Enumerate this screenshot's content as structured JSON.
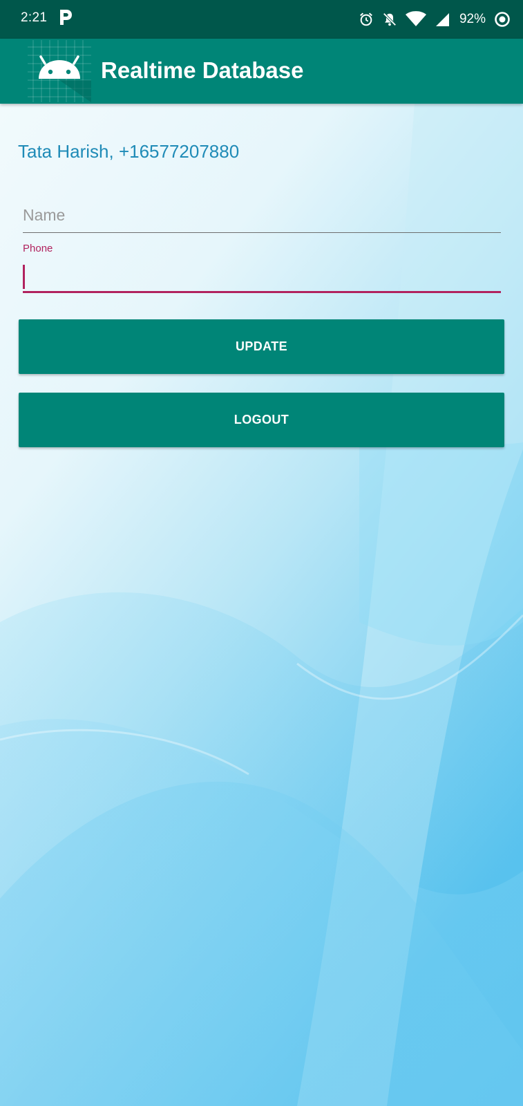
{
  "status_bar": {
    "time": "2:21",
    "battery_text": "92%",
    "icons": [
      "p-icon",
      "alarm-icon",
      "notifications-off-icon",
      "wifi-icon",
      "cell-signal-icon",
      "battery-saver-icon"
    ]
  },
  "app_bar": {
    "title": "Realtime Database",
    "icon": "android-icon"
  },
  "user": {
    "info": "Tata Harish, +16577207880"
  },
  "form": {
    "name_placeholder": "Name",
    "name_value": "",
    "phone_label": "Phone",
    "phone_value": ""
  },
  "buttons": {
    "update_label": "UPDATE",
    "logout_label": "LOGOUT"
  },
  "colors": {
    "status_bar": "#00574b",
    "app_bar": "#008577",
    "accent": "#b1225e",
    "user_text": "#1f8bb7"
  }
}
